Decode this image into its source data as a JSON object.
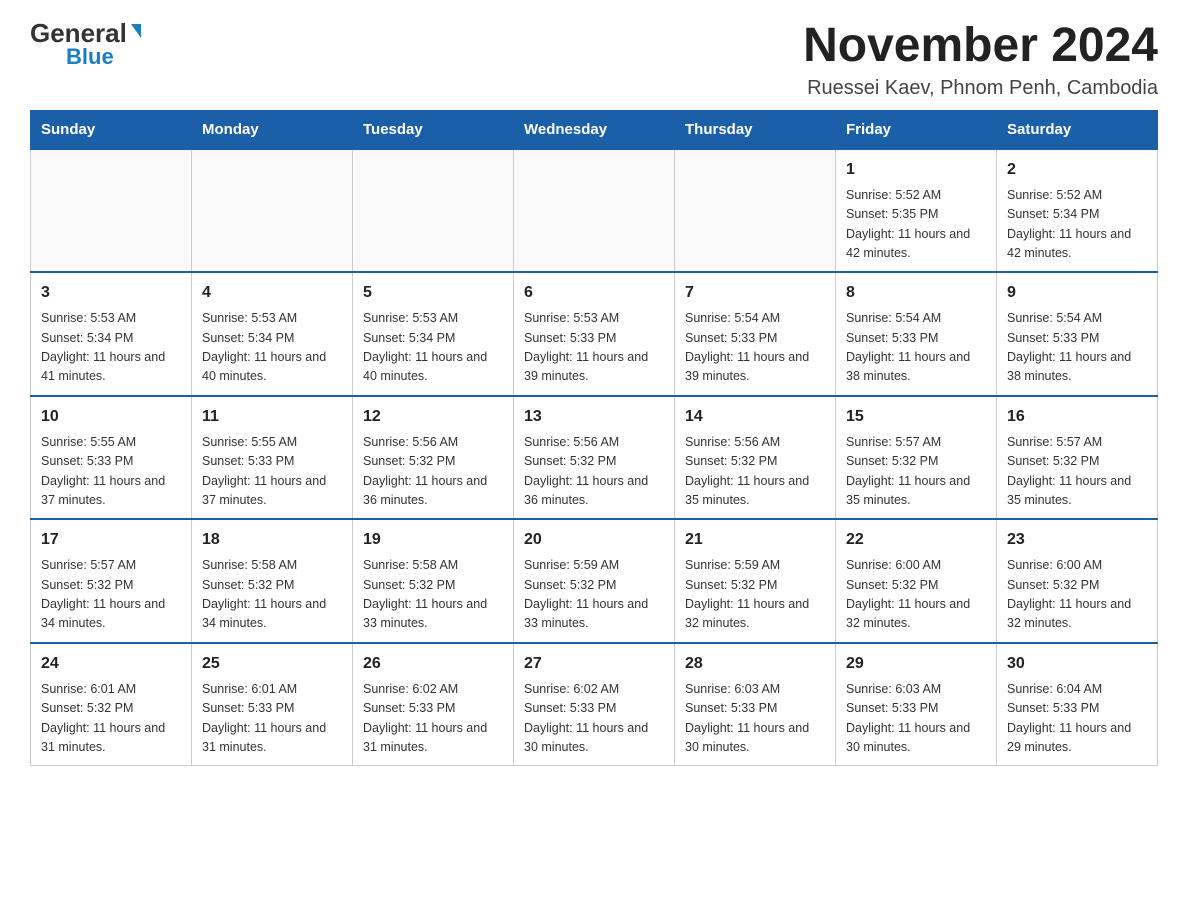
{
  "header": {
    "logo_general": "General",
    "logo_blue": "Blue",
    "month_title": "November 2024",
    "location": "Ruessei Kaev, Phnom Penh, Cambodia"
  },
  "calendar": {
    "days_of_week": [
      "Sunday",
      "Monday",
      "Tuesday",
      "Wednesday",
      "Thursday",
      "Friday",
      "Saturday"
    ],
    "weeks": [
      [
        {
          "day": "",
          "info": ""
        },
        {
          "day": "",
          "info": ""
        },
        {
          "day": "",
          "info": ""
        },
        {
          "day": "",
          "info": ""
        },
        {
          "day": "",
          "info": ""
        },
        {
          "day": "1",
          "info": "Sunrise: 5:52 AM\nSunset: 5:35 PM\nDaylight: 11 hours and 42 minutes."
        },
        {
          "day": "2",
          "info": "Sunrise: 5:52 AM\nSunset: 5:34 PM\nDaylight: 11 hours and 42 minutes."
        }
      ],
      [
        {
          "day": "3",
          "info": "Sunrise: 5:53 AM\nSunset: 5:34 PM\nDaylight: 11 hours and 41 minutes."
        },
        {
          "day": "4",
          "info": "Sunrise: 5:53 AM\nSunset: 5:34 PM\nDaylight: 11 hours and 40 minutes."
        },
        {
          "day": "5",
          "info": "Sunrise: 5:53 AM\nSunset: 5:34 PM\nDaylight: 11 hours and 40 minutes."
        },
        {
          "day": "6",
          "info": "Sunrise: 5:53 AM\nSunset: 5:33 PM\nDaylight: 11 hours and 39 minutes."
        },
        {
          "day": "7",
          "info": "Sunrise: 5:54 AM\nSunset: 5:33 PM\nDaylight: 11 hours and 39 minutes."
        },
        {
          "day": "8",
          "info": "Sunrise: 5:54 AM\nSunset: 5:33 PM\nDaylight: 11 hours and 38 minutes."
        },
        {
          "day": "9",
          "info": "Sunrise: 5:54 AM\nSunset: 5:33 PM\nDaylight: 11 hours and 38 minutes."
        }
      ],
      [
        {
          "day": "10",
          "info": "Sunrise: 5:55 AM\nSunset: 5:33 PM\nDaylight: 11 hours and 37 minutes."
        },
        {
          "day": "11",
          "info": "Sunrise: 5:55 AM\nSunset: 5:33 PM\nDaylight: 11 hours and 37 minutes."
        },
        {
          "day": "12",
          "info": "Sunrise: 5:56 AM\nSunset: 5:32 PM\nDaylight: 11 hours and 36 minutes."
        },
        {
          "day": "13",
          "info": "Sunrise: 5:56 AM\nSunset: 5:32 PM\nDaylight: 11 hours and 36 minutes."
        },
        {
          "day": "14",
          "info": "Sunrise: 5:56 AM\nSunset: 5:32 PM\nDaylight: 11 hours and 35 minutes."
        },
        {
          "day": "15",
          "info": "Sunrise: 5:57 AM\nSunset: 5:32 PM\nDaylight: 11 hours and 35 minutes."
        },
        {
          "day": "16",
          "info": "Sunrise: 5:57 AM\nSunset: 5:32 PM\nDaylight: 11 hours and 35 minutes."
        }
      ],
      [
        {
          "day": "17",
          "info": "Sunrise: 5:57 AM\nSunset: 5:32 PM\nDaylight: 11 hours and 34 minutes."
        },
        {
          "day": "18",
          "info": "Sunrise: 5:58 AM\nSunset: 5:32 PM\nDaylight: 11 hours and 34 minutes."
        },
        {
          "day": "19",
          "info": "Sunrise: 5:58 AM\nSunset: 5:32 PM\nDaylight: 11 hours and 33 minutes."
        },
        {
          "day": "20",
          "info": "Sunrise: 5:59 AM\nSunset: 5:32 PM\nDaylight: 11 hours and 33 minutes."
        },
        {
          "day": "21",
          "info": "Sunrise: 5:59 AM\nSunset: 5:32 PM\nDaylight: 11 hours and 32 minutes."
        },
        {
          "day": "22",
          "info": "Sunrise: 6:00 AM\nSunset: 5:32 PM\nDaylight: 11 hours and 32 minutes."
        },
        {
          "day": "23",
          "info": "Sunrise: 6:00 AM\nSunset: 5:32 PM\nDaylight: 11 hours and 32 minutes."
        }
      ],
      [
        {
          "day": "24",
          "info": "Sunrise: 6:01 AM\nSunset: 5:32 PM\nDaylight: 11 hours and 31 minutes."
        },
        {
          "day": "25",
          "info": "Sunrise: 6:01 AM\nSunset: 5:33 PM\nDaylight: 11 hours and 31 minutes."
        },
        {
          "day": "26",
          "info": "Sunrise: 6:02 AM\nSunset: 5:33 PM\nDaylight: 11 hours and 31 minutes."
        },
        {
          "day": "27",
          "info": "Sunrise: 6:02 AM\nSunset: 5:33 PM\nDaylight: 11 hours and 30 minutes."
        },
        {
          "day": "28",
          "info": "Sunrise: 6:03 AM\nSunset: 5:33 PM\nDaylight: 11 hours and 30 minutes."
        },
        {
          "day": "29",
          "info": "Sunrise: 6:03 AM\nSunset: 5:33 PM\nDaylight: 11 hours and 30 minutes."
        },
        {
          "day": "30",
          "info": "Sunrise: 6:04 AM\nSunset: 5:33 PM\nDaylight: 11 hours and 29 minutes."
        }
      ]
    ]
  }
}
